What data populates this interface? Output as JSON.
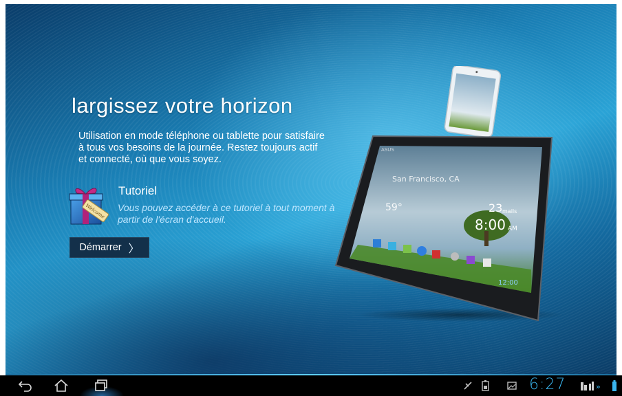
{
  "hero": {
    "title": "largissez votre horizon",
    "description": "Utilisation en mode téléphone ou tablette pour satisfaire à tous vos besoins de la journée. Restez toujours actif et connecté, où que vous soyez."
  },
  "tutorial": {
    "title": "Tutoriel",
    "description": "Vous pouvez accéder à ce tutoriel à tout moment à partir de l'écran d'accueil.",
    "gift_icon": "welcome-gift-icon",
    "start_label": "Démarrer"
  },
  "device_image": {
    "tablet_brand": "ASUS",
    "city": "San Francisco, CA",
    "temperature": "59°",
    "widget_time": "8:00",
    "widget_ampm": "AM",
    "widget_temp": "23",
    "widget_unit": "mails",
    "tablet_clock": "12:00"
  },
  "navbar": {
    "buttons": [
      "back-icon",
      "home-icon",
      "recent-apps-icon"
    ],
    "clock": "6:27",
    "status_icons": [
      "usb-debug-icon",
      "battery-keyboard-icon",
      "screenshot-icon",
      "signal-icon",
      "battery-icon"
    ],
    "accent": "#3ab6f0"
  }
}
